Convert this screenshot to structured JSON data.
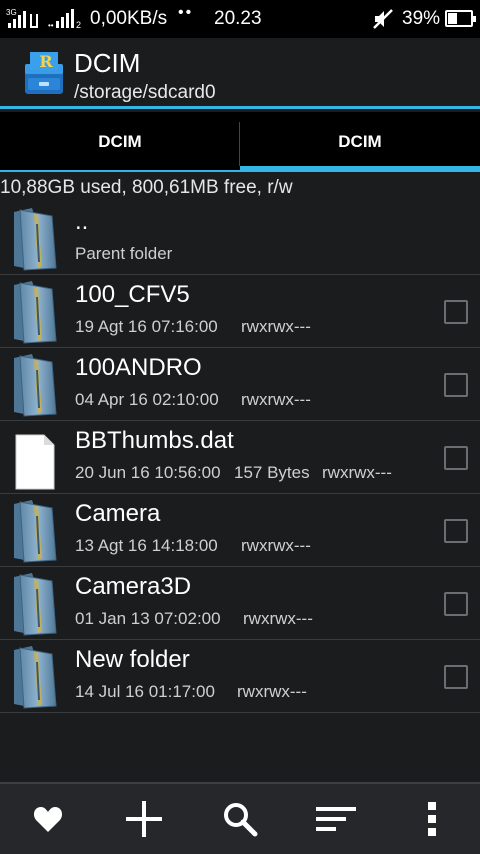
{
  "status_bar": {
    "sim1_tag": "3G",
    "sim2_tag": "2",
    "network_speed": "0,00KB/s",
    "network_dots": "••",
    "time": "20.23",
    "battery_percent": "39%",
    "battery_level": 0.39,
    "icons": [
      "signal-icon",
      "data-arrows-icon",
      "signal-icon",
      "mute-icon",
      "battery-icon"
    ]
  },
  "header": {
    "title": "DCIM",
    "path": "/storage/sdcard0",
    "app_icon": "root-explorer-icon",
    "accent_color": "#33b5e5"
  },
  "tabs": [
    {
      "label": "DCIM",
      "active": false
    },
    {
      "label": "DCIM",
      "active": true
    }
  ],
  "storage_info": "10,88GB used, 800,61MB free, r/w",
  "files": [
    {
      "name": "..",
      "date": "Parent folder",
      "size": "",
      "perm": "",
      "type": "folder",
      "has_checkbox": false
    },
    {
      "name": "100_CFV5",
      "date": "19 Agt 16 07:16:00",
      "size": "",
      "perm": "rwxrwx---",
      "type": "folder",
      "has_checkbox": true
    },
    {
      "name": "100ANDRO",
      "date": "04 Apr 16 02:10:00",
      "size": "",
      "perm": "rwxrwx---",
      "type": "folder",
      "has_checkbox": true
    },
    {
      "name": "BBThumbs.dat",
      "date": "20 Jun 16 10:56:00",
      "size": "157 Bytes",
      "perm": "rwxrwx---",
      "type": "file",
      "has_checkbox": true
    },
    {
      "name": "Camera",
      "date": "13 Agt 16 14:18:00",
      "size": "",
      "perm": "rwxrwx---",
      "type": "folder",
      "has_checkbox": true
    },
    {
      "name": "Camera3D",
      "date": "01 Jan 13 07:02:00",
      "size": "",
      "perm": "rwxrwx---",
      "type": "folder",
      "has_checkbox": true
    },
    {
      "name": "New folder",
      "date": "14 Jul 16 01:17:00",
      "size": "",
      "perm": "rwxrwx---",
      "type": "folder",
      "has_checkbox": true
    }
  ],
  "bottom_bar": [
    {
      "icon": "heart-icon",
      "action": "favorites"
    },
    {
      "icon": "plus-icon",
      "action": "new"
    },
    {
      "icon": "search-icon",
      "action": "search"
    },
    {
      "icon": "sort-icon",
      "action": "sort"
    },
    {
      "icon": "overflow-menu-icon",
      "action": "more"
    }
  ]
}
